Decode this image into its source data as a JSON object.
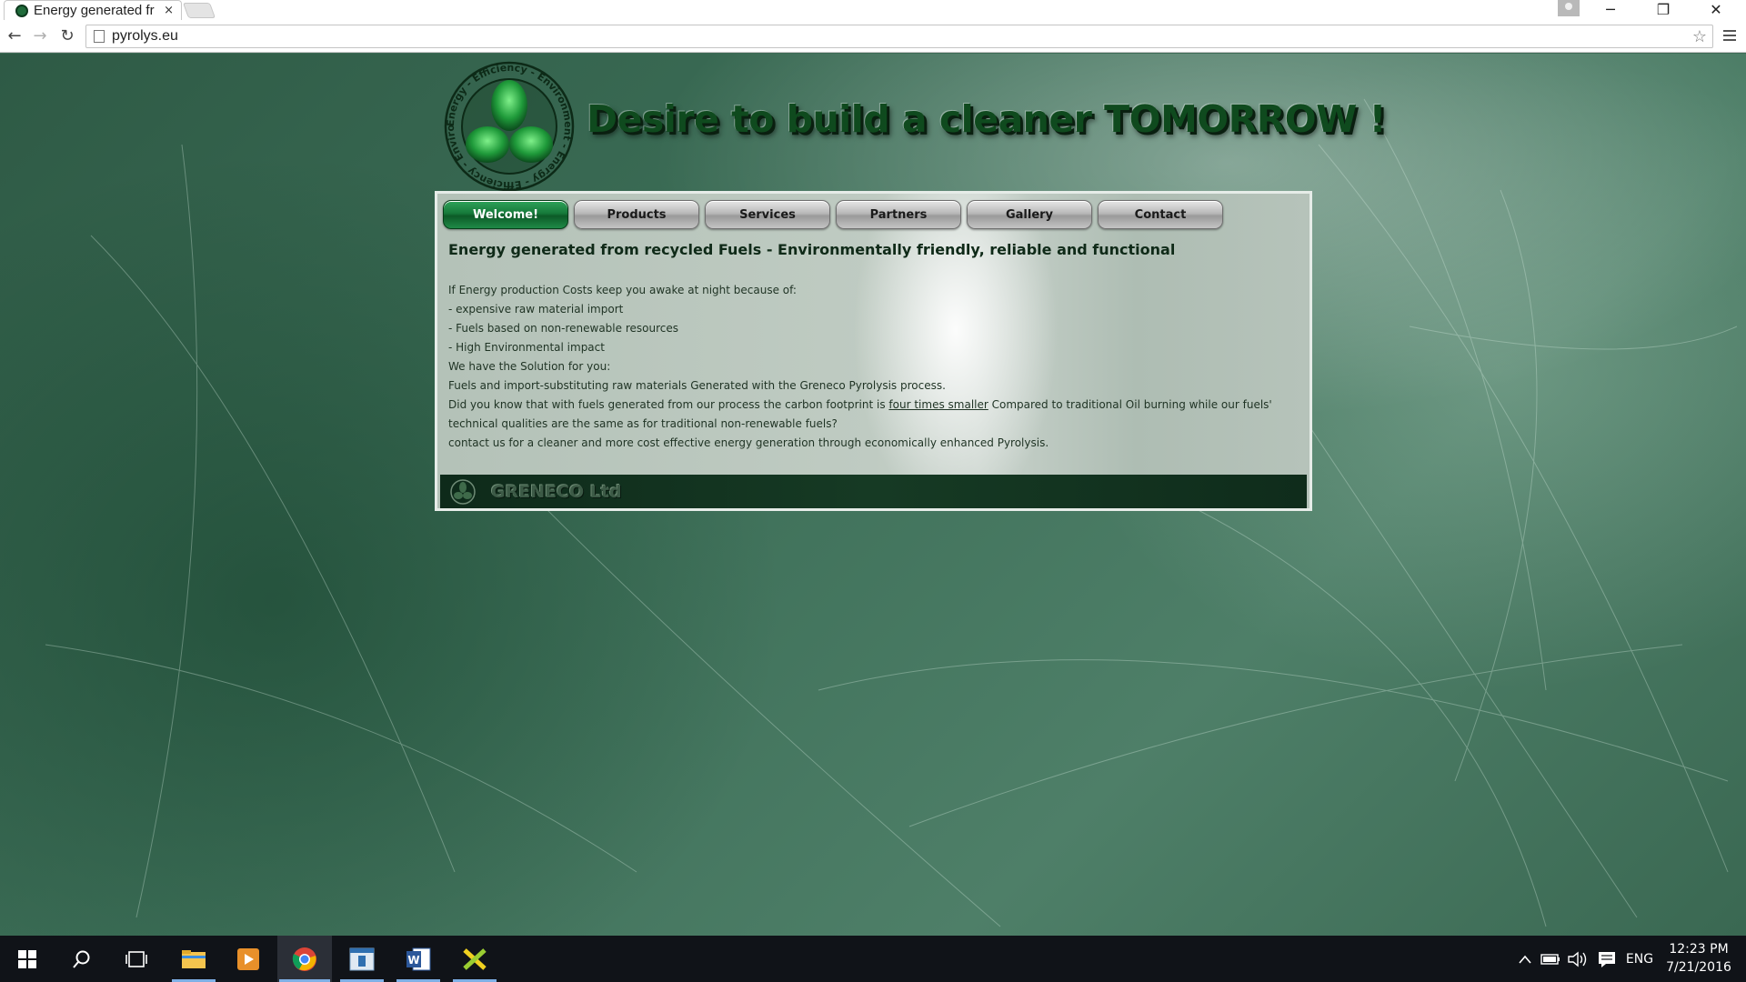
{
  "browser": {
    "tab_title": "Energy generated fr",
    "tab_close": "×",
    "url": "pyrolys.eu",
    "back": "←",
    "forward": "→",
    "reload": "↻",
    "star": "☆",
    "minimize": "─",
    "maximize": "❐",
    "close": "✕"
  },
  "header": {
    "headline": "Desire to build a cleaner TOMORROW !",
    "logo_ring_text": "Energy - Efficiency - Environment - Energy - Efficiency - Environment -"
  },
  "nav": {
    "items": [
      {
        "label": "Welcome!",
        "active": true
      },
      {
        "label": "Products",
        "active": false
      },
      {
        "label": "Services",
        "active": false
      },
      {
        "label": "Partners",
        "active": false
      },
      {
        "label": "Gallery",
        "active": false
      },
      {
        "label": "Contact",
        "active": false
      }
    ]
  },
  "content": {
    "headline": "Energy generated from recycled Fuels -  Environmentally friendly, reliable and functional",
    "line1": "If Energy production Costs keep you awake at night because of:",
    "line2": "- expensive raw material import",
    "line3": "- Fuels based on non-renewable resources",
    "line4": "- High Environmental impact",
    "line5": "We have the Solution for you:",
    "line6": "Fuels and import-substituting raw materials Generated with the Greneco Pyrolysis process.",
    "line7_pre": "Did you know that with fuels generated from our process the carbon footprint is ",
    "line7_link": "four times smaller",
    "line7_post": " Compared to traditional Oil burning while our fuels' technical qualities are the same as for traditional non-renewable fuels?",
    "line8": "contact us for a cleaner and more cost effective energy generation through economically enhanced Pyrolysis."
  },
  "footer": {
    "company": "GRENECO Ltd"
  },
  "taskbar": {
    "language": "ENG",
    "time": "12:23 PM",
    "date": "7/21/2016"
  },
  "colors": {
    "brand_green": "#0f4a1e",
    "active_nav": "#167a3a",
    "footer_bar": "#163a24"
  }
}
